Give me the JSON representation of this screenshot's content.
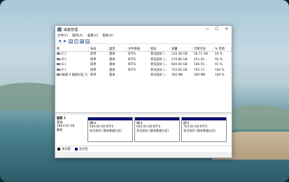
{
  "window": {
    "title": "磁盘管理",
    "controls": [
      "—",
      "☐",
      "✕"
    ]
  },
  "menu": [
    "文件(F)",
    "操作(A)",
    "查看(V)",
    "帮助(H)"
  ],
  "toolbar": [
    "◀",
    "▶",
    "▤",
    "?",
    "▦",
    "▤"
  ],
  "table": {
    "headers": [
      "卷",
      "布局",
      "类型",
      "文件系统",
      "状态",
      "容量",
      "可用空间",
      "% 可用"
    ],
    "rows": [
      [
        "(C:)",
        "简单",
        "基本",
        "NTFS",
        "状况良好 (...",
        "232.58 GB",
        "56.71 GB",
        "24 %"
      ],
      [
        "(D:)",
        "简单",
        "基本",
        "NTFS",
        "状况良好 (...",
        "476.86 GB",
        "451.05...",
        "95 %"
      ],
      [
        "(E:)",
        "简单",
        "基本",
        "NTFS",
        "状况良好 (...",
        "600.00 GB",
        "546.55...",
        "91 %"
      ],
      [
        "(F:)",
        "简单",
        "基本",
        "NTFS",
        "状况良好 (...",
        "763.02 GB",
        "762.17...",
        "100 %"
      ],
      [
        "(磁盘 0 磁盘分区 1)",
        "简单",
        "基本",
        "",
        "状况良好 (...",
        "300 MB",
        "300 MB",
        "100 %"
      ]
    ]
  },
  "disk": {
    "name": "磁盘 1",
    "type": "基本",
    "size": "1863.02 GB",
    "status": "联机"
  },
  "partitions": [
    {
      "label": "(D:)",
      "size": "500.00 GB NTFS",
      "status": "状况良好 (基本数据分区)"
    },
    {
      "label": "(E:)",
      "size": "600.00 GB NTFS",
      "status": "状况良好 (基本数据分区)"
    },
    {
      "label": "(F:)",
      "size": "763.02 GB NTFS",
      "status": "状况良好 (基本数据分区)"
    }
  ],
  "legend": {
    "unallocated": "未分配",
    "primary": "主分区"
  },
  "colors": {
    "partition_bar": "#0b0f73",
    "unallocated": "#000000"
  }
}
